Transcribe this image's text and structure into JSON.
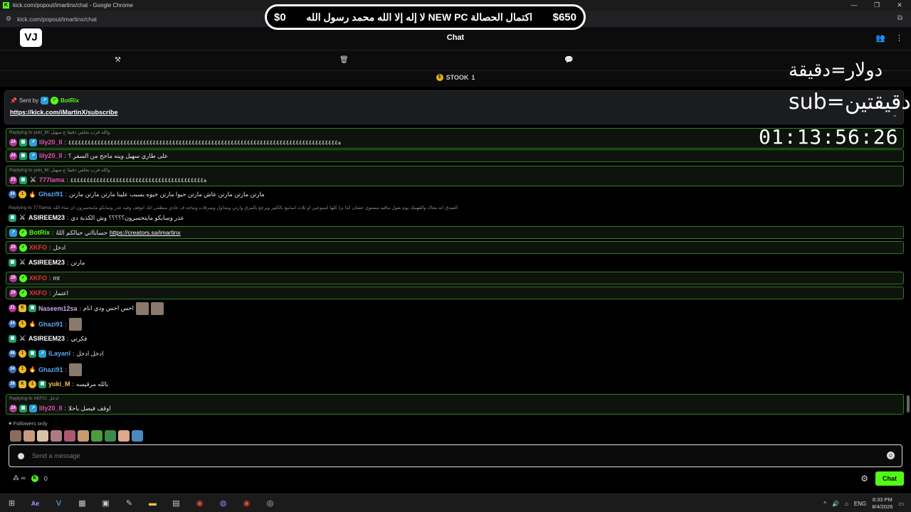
{
  "window": {
    "title": "kick.com/popout/imartinx/chat - Google Chrome",
    "url": "kick.com/popout/imartinx/chat"
  },
  "banner": {
    "left_amount": "$0",
    "middle": "لا إله إلا الله محمد رسول الله  NEW PC اكتمال الحصالة",
    "right_amount": "$650"
  },
  "header": {
    "logo": "VJ",
    "title": "Chat"
  },
  "stook": {
    "label": "STOOK",
    "count": "1"
  },
  "pinned": {
    "sent_by": "Sent by",
    "bot": "BotRix",
    "link": "https://kick.com/iMartinX/subscribe"
  },
  "overlay": {
    "line1": "دولار=دقيقة",
    "line2": "sub=دقيقتين",
    "timer": "01:13:56:26"
  },
  "messages": [
    {
      "reply": "Replying to yuki_M: والله قرب بحلص دقيقا ع سهيل",
      "user": "lily20_ll",
      "color": "#e34fb5",
      "text": "ة٤٤٤٤٤٤٤٤٤٤٤٤٤٤٤٤٤٤٤٤٤٤٤٤٤٤٤٤٤٤٤٤٤٤٤٤٤٤٤٤٤٤٤٤٤٤٤٤٤٤٤٤٤٤٤٤٤٤٤٤٤٤٤٤٤٤٤٤٤٤٤٤٤٤٤٤٤٤٤٤٤٤٤"
    },
    {
      "user": "lily20_ll",
      "color": "#e34fb5",
      "text": "على طاري سهيل وينه ماجح من السفر ؟"
    },
    {
      "reply": "Replying to yuki_M: والله قرب بحلص دقيقا ع سهيل",
      "user": "777lama",
      "color": "#e34fb5",
      "text": "ة٤٤٤٤٤٤٤٤٤٤٤٤٤٤٤٤٤٤٤٤٤٤٤٤٤٤٤٤٤٤٤٤٤٤٤٤٤٤٤٤٤"
    },
    {
      "user": "Ghazi91",
      "color": "#5aa8f0",
      "text": "مارتن مارتن مارتن عاش مارتن حيوا مارتن حيوه بسبب علينا مارتن مارتن مارتن"
    },
    {
      "reply": "Replying to 777lama: الصدق انه معاك والفهمك يوم بقول ماقيه مستوى عشان كذا نزا كلها اسبوعين او ثلاث اسابيع بالكثير ويرجع بالمرق وارتي ومداول وسرقات ونياجه ف عادي منطقي انك اتوقف وفيه عذر وسابكو مايتحسرون ان شاء الله",
      "user": "ASIREEM23",
      "color": "#ffffff",
      "text": "عذر وسابكو مايتحسرون؟؟؟؟؟ وش الكذبة دي"
    },
    {
      "user": "BotRix",
      "color": "#53fc18",
      "text": "حسابااتي حيالكم اللهُ",
      "link": "https://creators.sa/imartinx"
    },
    {
      "user": "XKFO",
      "color": "#e5322d",
      "text": "ادخل"
    },
    {
      "user": "ASIREEM23",
      "color": "#ffffff",
      "text": "مارتن"
    },
    {
      "user": "XKFO",
      "color": "#e5322d",
      "text": "mt"
    },
    {
      "user": "XKFO",
      "color": "#e5322d",
      "text": "اعتمار"
    },
    {
      "user": "Naseem12sa",
      "color": "#c9a8f0",
      "text": "احس احس ودي انام"
    },
    {
      "user": "Ghazi91",
      "color": "#5aa8f0",
      "text": ""
    },
    {
      "user": "ASIREEM23",
      "color": "#ffffff",
      "text": "فكرتي"
    },
    {
      "user": "lLayanl",
      "color": "#5aa8f0",
      "text": "ادخل ادخل"
    },
    {
      "user": "Ghazi91",
      "color": "#5aa8f0",
      "text": ""
    },
    {
      "user": "yuki_M",
      "color": "#f5c542",
      "text": "بالله مرقيسه"
    },
    {
      "reply": "Replying to XKFO: ادخل",
      "user": "lily20_ll",
      "color": "#e34fb5",
      "text": "اوقف فيصل باحلا"
    }
  ],
  "footer": {
    "followers_only": "Followers only",
    "input_placeholder": "Send a message",
    "points": "0",
    "chat_button": "Chat"
  },
  "taskbar": {
    "lang": "ENG",
    "time": "8:33 PM",
    "date": "8/4/2026"
  }
}
